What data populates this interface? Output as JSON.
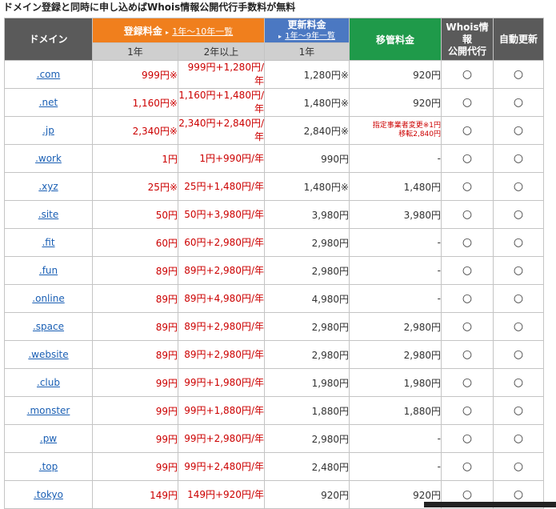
{
  "caption": "ドメイン登録と同時に申し込めばWhois情報公開代行手数料が無料",
  "header": {
    "domain": "ドメイン",
    "registration": "登録料金",
    "registration_arrow": "▸",
    "registration_link": "1年〜10年一覧",
    "renewal": "更新料金",
    "renewal_arrow": "▸",
    "renewal_link": "1年〜9年一覧",
    "transfer": "移管料金",
    "whois_line1": "Whois情報",
    "whois_line2": "公開代行",
    "auto_renew": "自動更新",
    "sub_reg_1y": "1年",
    "sub_reg_2y": "2年以上",
    "sub_renew_1y": "1年"
  },
  "colors": {
    "orange": "#f07f1d",
    "blue": "#4b78c2",
    "green": "#1f9a4a",
    "dark": "#5a5a5a",
    "price_red": "#cc0000",
    "link_blue": "#1a5fb4"
  },
  "rows": [
    {
      "domain": ".com",
      "reg1": "999円※",
      "reg2": "999円+1,280円/年",
      "renew": "1,280円※",
      "transfer": "920円",
      "whois": "○",
      "auto": "○"
    },
    {
      "domain": ".net",
      "reg1": "1,160円※",
      "reg2": "1,160円+1,480円/年",
      "renew": "1,480円※",
      "transfer": "920円",
      "whois": "○",
      "auto": "○"
    },
    {
      "domain": ".jp",
      "reg1": "2,340円※",
      "reg2": "2,340円+2,840円/年",
      "renew": "2,840円※",
      "transfer": "指定事業者変更※1円\n移転2,840円",
      "whois": "○",
      "auto": "○"
    },
    {
      "domain": ".work",
      "reg1": "1円",
      "reg2": "1円+990円/年",
      "renew": "990円",
      "transfer": "-",
      "whois": "○",
      "auto": "○"
    },
    {
      "domain": ".xyz",
      "reg1": "25円※",
      "reg2": "25円+1,480円/年",
      "renew": "1,480円※",
      "transfer": "1,480円",
      "whois": "○",
      "auto": "○"
    },
    {
      "domain": ".site",
      "reg1": "50円",
      "reg2": "50円+3,980円/年",
      "renew": "3,980円",
      "transfer": "3,980円",
      "whois": "○",
      "auto": "○"
    },
    {
      "domain": ".fit",
      "reg1": "60円",
      "reg2": "60円+2,980円/年",
      "renew": "2,980円",
      "transfer": "-",
      "whois": "○",
      "auto": "○"
    },
    {
      "domain": ".fun",
      "reg1": "89円",
      "reg2": "89円+2,980円/年",
      "renew": "2,980円",
      "transfer": "-",
      "whois": "○",
      "auto": "○"
    },
    {
      "domain": ".online",
      "reg1": "89円",
      "reg2": "89円+4,980円/年",
      "renew": "4,980円",
      "transfer": "-",
      "whois": "○",
      "auto": "○"
    },
    {
      "domain": ".space",
      "reg1": "89円",
      "reg2": "89円+2,980円/年",
      "renew": "2,980円",
      "transfer": "2,980円",
      "whois": "○",
      "auto": "○"
    },
    {
      "domain": ".website",
      "reg1": "89円",
      "reg2": "89円+2,980円/年",
      "renew": "2,980円",
      "transfer": "2,980円",
      "whois": "○",
      "auto": "○"
    },
    {
      "domain": ".club",
      "reg1": "99円",
      "reg2": "99円+1,980円/年",
      "renew": "1,980円",
      "transfer": "1,980円",
      "whois": "○",
      "auto": "○"
    },
    {
      "domain": ".monster",
      "reg1": "99円",
      "reg2": "99円+1,880円/年",
      "renew": "1,880円",
      "transfer": "1,880円",
      "whois": "○",
      "auto": "○"
    },
    {
      "domain": ".pw",
      "reg1": "99円",
      "reg2": "99円+2,980円/年",
      "renew": "2,980円",
      "transfer": "-",
      "whois": "○",
      "auto": "○"
    },
    {
      "domain": ".top",
      "reg1": "99円",
      "reg2": "99円+2,480円/年",
      "renew": "2,480円",
      "transfer": "-",
      "whois": "○",
      "auto": "○"
    },
    {
      "domain": ".tokyo",
      "reg1": "149円",
      "reg2": "149円+920円/年",
      "renew": "920円",
      "transfer": "920円",
      "whois": "○",
      "auto": "○"
    }
  ]
}
